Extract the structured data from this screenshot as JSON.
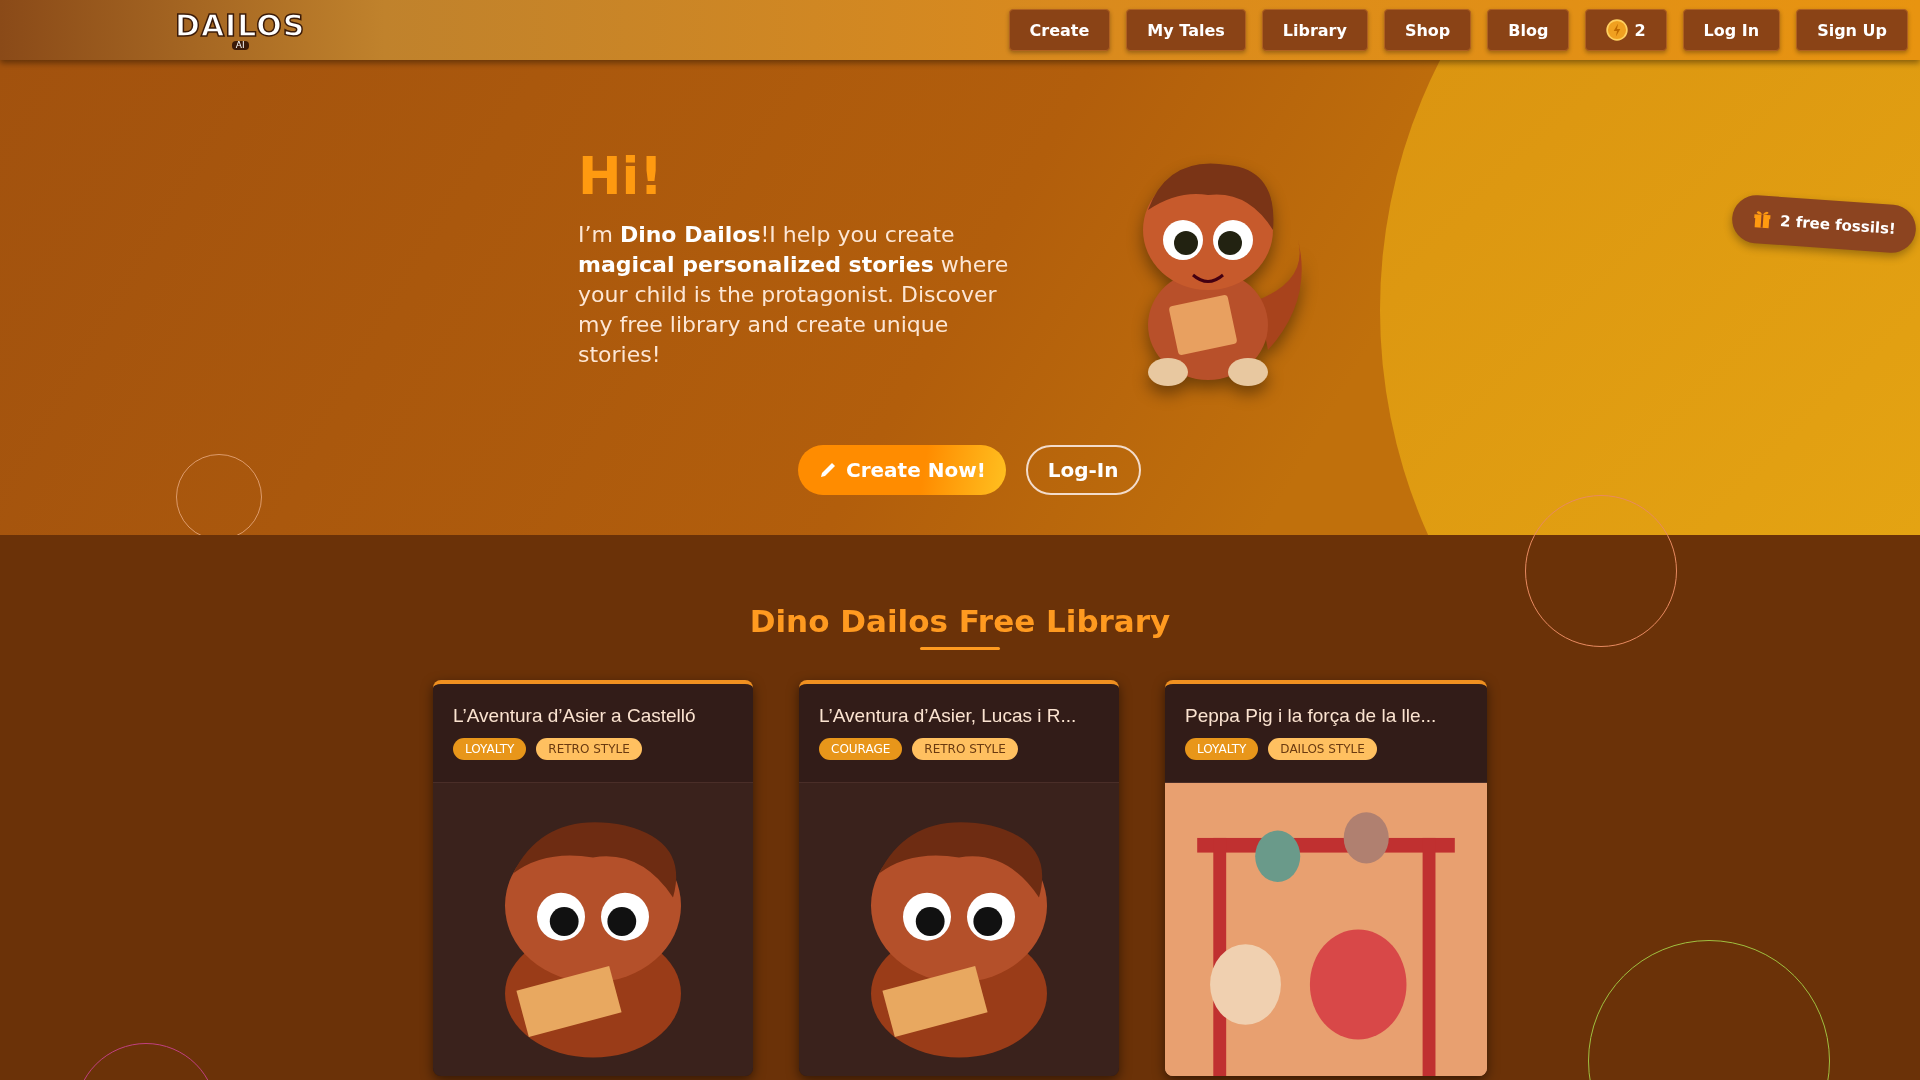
{
  "header": {
    "logo": {
      "text": "DAILOS",
      "sub": "AI"
    },
    "nav": [
      {
        "label": "Create",
        "kind": "link"
      },
      {
        "label": "My Tales",
        "kind": "link"
      },
      {
        "label": "Library",
        "kind": "link"
      },
      {
        "label": "Shop",
        "kind": "link"
      },
      {
        "label": "Blog",
        "kind": "link"
      },
      {
        "label": "2",
        "kind": "coins"
      },
      {
        "label": "Log In",
        "kind": "link"
      },
      {
        "label": "Sign Up",
        "kind": "link"
      }
    ]
  },
  "hero": {
    "greeting": "Hi!",
    "text": "I’m **Dino Dailos**!I help you create **magical personalized stories** where your child is the protagonist. Discover my free library and create unique stories!",
    "buttons": [
      {
        "label": "Create Now!",
        "kind": "primary"
      },
      {
        "label": "Log-In",
        "kind": "outline"
      }
    ],
    "promo": "2 free fossils!"
  },
  "library": {
    "title": "Dino Dailos Free Library",
    "cards": [
      {
        "title": "L’Aventura d’Asier a Castelló",
        "tags": [
          {
            "label": "LOYALTY",
            "kind": "theme"
          },
          {
            "label": "RETRO STYLE",
            "kind": "style"
          }
        ],
        "kind": "dino"
      },
      {
        "title": "L’Aventura d’Asier, Lucas i R...",
        "tags": [
          {
            "label": "COURAGE",
            "kind": "theme"
          },
          {
            "label": "RETRO STYLE",
            "kind": "style"
          }
        ],
        "kind": "dino"
      },
      {
        "title": "Peppa Pig i la força de la lle...",
        "tags": [
          {
            "label": "LOYALTY",
            "kind": "theme"
          },
          {
            "label": "DAILOS STYLE",
            "kind": "style"
          }
        ],
        "kind": "scene"
      }
    ]
  }
}
